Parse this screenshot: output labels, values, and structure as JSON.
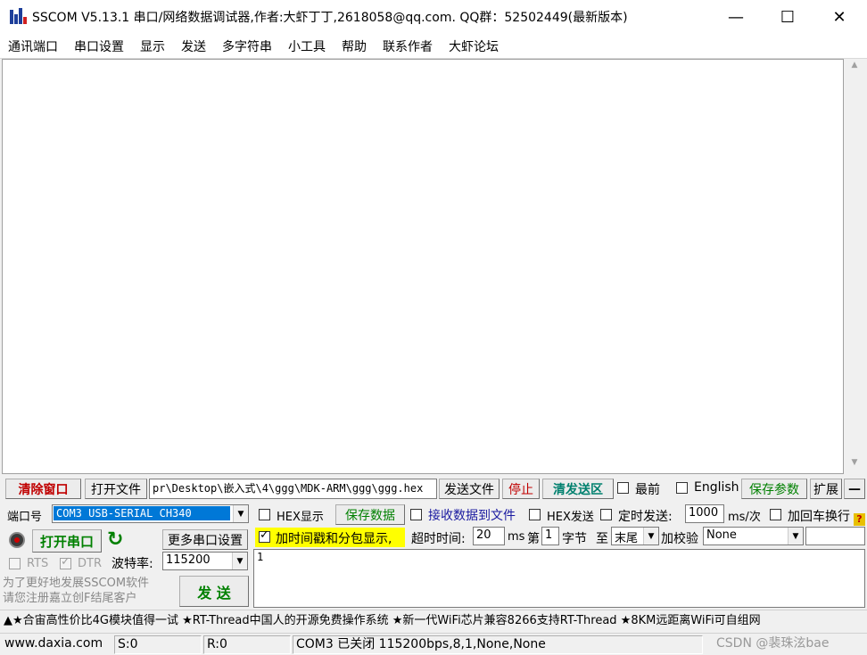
{
  "window": {
    "title": "SSCOM V5.13.1 串口/网络数据调试器,作者:大虾丁丁,2618058@qq.com. QQ群：52502449(最新版本)",
    "minimize": "—",
    "maximize": "☐",
    "close": "✕"
  },
  "menu": [
    "通讯端口",
    "串口设置",
    "显示",
    "发送",
    "多字符串",
    "小工具",
    "帮助",
    "联系作者",
    "大虾论坛"
  ],
  "toolbar": {
    "clear_window": "清除窗口",
    "open_file": "打开文件",
    "file_path": "pr\\Desktop\\嵌入式\\4\\ggg\\MDK-ARM\\ggg\\ggg.hex",
    "send_file": "发送文件",
    "stop": "停止",
    "clear_send": "清发送区",
    "topmost": "最前",
    "english": "English",
    "save_params": "保存参数",
    "expand": "扩展",
    "collapse": "—"
  },
  "port": {
    "label": "端口号",
    "value": "COM3 USB-SERIAL CH340",
    "open_button": "打开串口",
    "more_settings": "更多串口设置",
    "rts": "RTS",
    "dtr": "DTR",
    "baud_label": "波特率:",
    "baud_value": "115200",
    "promo": "为了更好地发展SSCOM软件\n请您注册嘉立创F结尾客户",
    "send_button": "发 送"
  },
  "options": {
    "hex_display": "HEX显示",
    "save_data": "保存数据",
    "recv_to_file": "接收数据到文件",
    "hex_send": "HEX发送",
    "timed_send": "定时发送:",
    "interval": "1000",
    "interval_unit": "ms/次",
    "add_crlf": "加回车换行",
    "timestamp": "加时间戳和分包显示,",
    "timeout_label": "超时时间:",
    "timeout_value": "20",
    "timeout_unit": "ms",
    "byte_from_label": "第",
    "byte_from": "1",
    "byte_unit": "字节",
    "to_label": "至",
    "byte_to": "末尾",
    "checksum_label": "加校验",
    "checksum_value": "None"
  },
  "send_area": {
    "text": "1"
  },
  "ticker": "▲★合宙高性价比4G模块值得一试 ★RT-Thread中国人的开源免费操作系统 ★新一代WiFi芯片兼容8266支持RT-Thread ★8KM远距离WiFi可自组网",
  "status": {
    "site": "www.daxia.com",
    "sent": "S:0",
    "received": "R:0",
    "port_state": "COM3 已关闭  115200bps,8,1,None,None",
    "watermark": "CSDN @裴珠泫bae"
  },
  "colors": {
    "accent_red": "#c00000",
    "accent_green": "#008000",
    "selection_blue": "#0078d7",
    "highlight_yellow": "#ffff00"
  }
}
